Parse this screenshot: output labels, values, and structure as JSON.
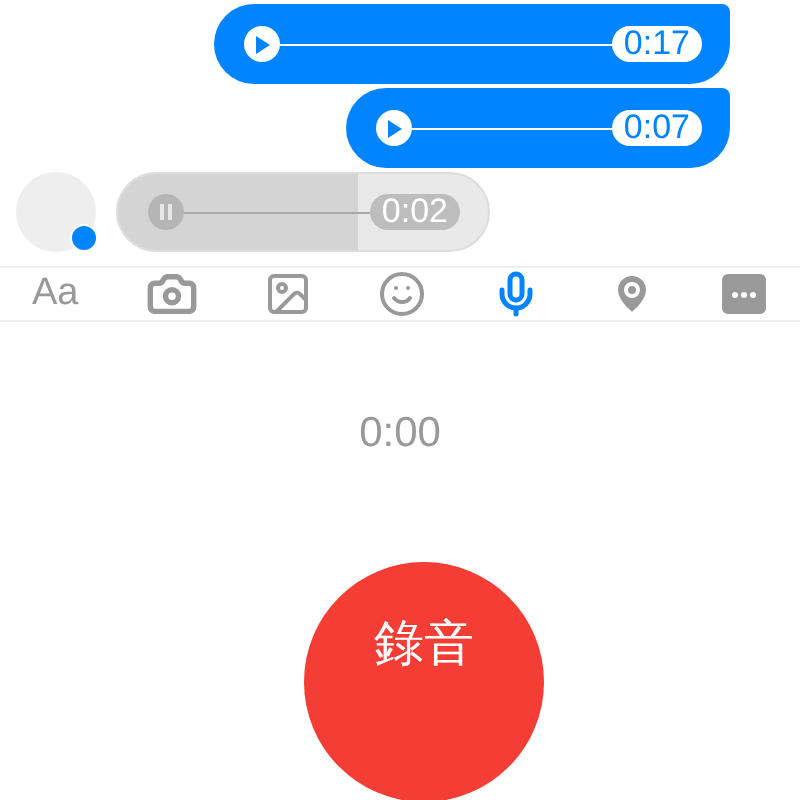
{
  "messages": [
    {
      "kind": "sent",
      "duration": "0:17",
      "playing": false
    },
    {
      "kind": "sent",
      "duration": "0:07",
      "playing": false
    },
    {
      "kind": "received",
      "duration": "0:02",
      "playing": true,
      "level": 0.65
    }
  ],
  "toolbar": [
    {
      "label": "Aa",
      "selected": false
    },
    {
      "selected": false
    },
    {
      "selected": false
    },
    {
      "selected": false
    },
    {
      "selected": true
    },
    {
      "selected": false
    },
    {
      "selected": false
    }
  ],
  "recorder": {
    "timer": "0:00",
    "button": "錄音"
  }
}
